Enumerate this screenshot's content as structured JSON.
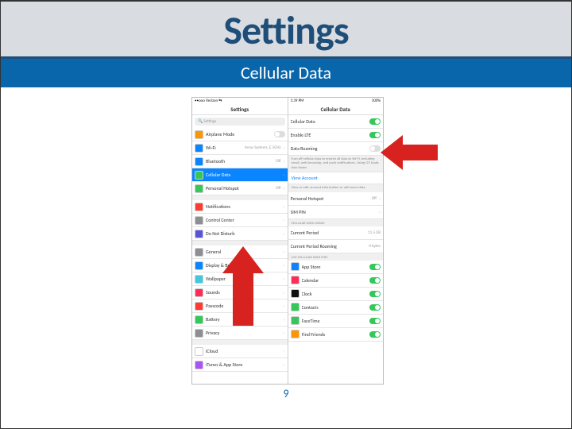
{
  "slide": {
    "title": "Settings",
    "subtitle": "Cellular Data",
    "page_number": "9"
  },
  "status": {
    "carrier": "••ooo Verizon ⇆",
    "time": "1:39 PM",
    "battery": "100%"
  },
  "nav": {
    "left_title": "Settings",
    "right_title": "Cellular Data",
    "search_placeholder": "Settings"
  },
  "left_rows": [
    {
      "icon": "#ff9500",
      "label": "Airplane Mode",
      "toggle": "off"
    },
    {
      "icon": "#0a84ff",
      "label": "Wi-Fi",
      "value": "Asrus Systems_E 5GHz"
    },
    {
      "icon": "#0a84ff",
      "label": "Bluetooth",
      "value": "Off"
    },
    {
      "icon": "#34c759",
      "label": "Cellular Data",
      "selected": true
    },
    {
      "icon": "#34c759",
      "label": "Personal Hotspot",
      "value": "Off"
    },
    {
      "spacer": true
    },
    {
      "icon": "#ff3b30",
      "label": "Notifications"
    },
    {
      "icon": "#8e8e93",
      "label": "Control Center"
    },
    {
      "icon": "#5856d6",
      "label": "Do Not Disturb"
    },
    {
      "spacer": true
    },
    {
      "icon": "#8e8e93",
      "label": "General"
    },
    {
      "icon": "#0a84ff",
      "label": "Display & Brightness"
    },
    {
      "icon": "#40c8e0",
      "label": "Wallpaper"
    },
    {
      "icon": "#ff2d55",
      "label": "Sounds"
    },
    {
      "icon": "#ff3b30",
      "label": "Passcode"
    },
    {
      "icon": "#34c759",
      "label": "Battery"
    },
    {
      "icon": "#8e8e93",
      "label": "Privacy"
    },
    {
      "spacer": true
    },
    {
      "icon": "#ffffff",
      "label": "iCloud"
    },
    {
      "icon": "#a855f7",
      "label": "iTunes & App Store"
    }
  ],
  "right_top": [
    {
      "label": "Cellular Data",
      "toggle": "on"
    },
    {
      "label": "Enable LTE",
      "toggle": "on"
    },
    {
      "label": "Data Roaming",
      "toggle": "off"
    }
  ],
  "right_note": "Turn off cellular data to restrict all data to Wi-Fi, including email, web browsing, and push notifications. Using LTE loads data faster.",
  "right_link": "View Account",
  "right_note2": "View or edit account information or add more data.",
  "right_mid": [
    {
      "label": "Personal Hotspot",
      "value": "Off"
    },
    {
      "label": "SIM PIN"
    }
  ],
  "usage_header": "CELLULAR DATA USAGE",
  "usage_rows": [
    {
      "label": "Current Period",
      "value": "11.5 GB"
    },
    {
      "label": "Current Period Roaming",
      "value": "0 bytes"
    }
  ],
  "apps_header": "USE CELLULAR DATA FOR:",
  "app_rows": [
    {
      "icon": "#0a84ff",
      "label": "App Store",
      "toggle": "on"
    },
    {
      "icon": "#ff2d55",
      "label": "Calendar",
      "toggle": "on"
    },
    {
      "icon": "#111111",
      "label": "Clock",
      "toggle": "on"
    },
    {
      "icon": "#34c759",
      "label": "Contacts",
      "toggle": "on"
    },
    {
      "icon": "#34c759",
      "label": "FaceTime",
      "toggle": "on"
    },
    {
      "icon": "#ff9500",
      "label": "Find Friends",
      "toggle": "on"
    }
  ]
}
